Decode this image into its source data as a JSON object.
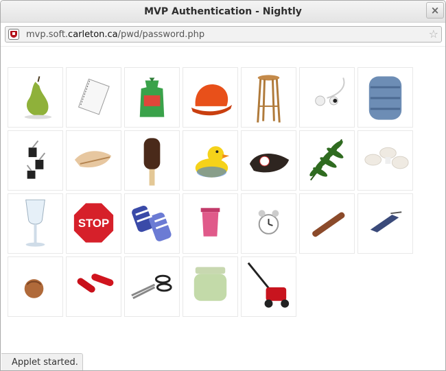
{
  "window": {
    "title": "MVP Authentication - Nightly",
    "close_label": "×"
  },
  "addressbar": {
    "url_prefix": "mvp.soft.",
    "url_domain": "carleton.ca",
    "url_path": "/pwd/password.php",
    "site_icon": "carleton-shield-icon",
    "bookmark_icon": "star-icon"
  },
  "images": [
    {
      "name": "pear"
    },
    {
      "name": "notepad"
    },
    {
      "name": "candy-bag"
    },
    {
      "name": "hard-hat"
    },
    {
      "name": "stool"
    },
    {
      "name": "earbuds"
    },
    {
      "name": "sleeping-bag"
    },
    {
      "name": "binder-clips"
    },
    {
      "name": "seashell"
    },
    {
      "name": "ice-cream-bar"
    },
    {
      "name": "rubber-duck"
    },
    {
      "name": "baseball-glove"
    },
    {
      "name": "fern-leaf"
    },
    {
      "name": "mushrooms"
    },
    {
      "name": "water-glass"
    },
    {
      "name": "stop-sign"
    },
    {
      "name": "striped-gloves"
    },
    {
      "name": "trash-can"
    },
    {
      "name": "alarm-clock"
    },
    {
      "name": "cigar"
    },
    {
      "name": "hair-clip"
    },
    {
      "name": "hazelnut"
    },
    {
      "name": "red-capsules"
    },
    {
      "name": "scissors"
    },
    {
      "name": "glass-jar"
    },
    {
      "name": "lawn-mower"
    }
  ],
  "stop_sign_text": "STOP",
  "status": {
    "text": "Applet started."
  }
}
